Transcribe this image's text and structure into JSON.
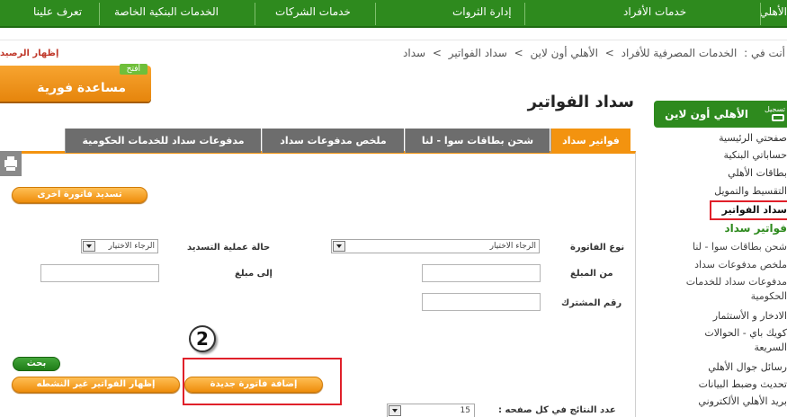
{
  "topnav": {
    "items": [
      "الأهلي",
      "خدمات الأفراد",
      "إدارة الثروات",
      "خدمات الشركات",
      "الخدمات البنكية الخاصة",
      "تعرف علينا"
    ]
  },
  "breadcrumb": {
    "prefix": "أنت في :",
    "items": [
      "الخدمات المصرفية للأفراد",
      "الأهلي أون لاين",
      "سداد الفواتير",
      "سداد"
    ],
    "sep": ">"
  },
  "show_balance": "إظهار الرصيد",
  "quick_help": {
    "badge": "أفتح",
    "label": "مساعدة فورية"
  },
  "page_title": "سداد الفواتير",
  "sidebar": {
    "header": "الأهلي أون لاين",
    "enter_label": "تسجيل",
    "items": [
      "صفحتي الرئيسية",
      "حساباتي البنكية",
      "بطاقات الأهلي",
      "التقسيط والتمويل",
      "سداد الفواتير",
      "فواتير سداد",
      "شحن بطاقات سوا - لنا",
      "ملخص مدفوعات سداد",
      "مدفوعات سداد للخدمات",
      "الحكومية",
      "الادخار و الأستثمار",
      "كويك باي - الحوالات",
      "السريعة",
      "رسائل جوال الأهلي",
      "تحديث وضبط البيانات",
      "بريد الأهلي الألكتروني"
    ]
  },
  "tabs": [
    {
      "label": "فواتير سداد",
      "active": true
    },
    {
      "label": "شحن بطاقات سوا - لنا",
      "active": false
    },
    {
      "label": "ملخص مدفوعات سداد",
      "active": false
    },
    {
      "label": "مدفوعات سداد للخدمات الحكومية",
      "active": false
    }
  ],
  "actions": {
    "pay_another": "تسديد فاتورة اخرى",
    "search": "بحث",
    "show_inactive": "إظهار الفواتير غير النشطه",
    "add_new": "إضافة فاتورة جديدة"
  },
  "form": {
    "bill_type_label": "نوع الفاتورة",
    "bill_type_value": "الرجاء الاختيار",
    "payment_status_label": "حالة عملية التسديد",
    "payment_status_value": "الرجاء الاختيار",
    "from_amount_label": "من المبلغ",
    "to_amount_label": "إلى مبلغ",
    "subscriber_label": "رقم المشترك",
    "results_per_page_label": "عدد النتائج في كل صفحه :",
    "results_per_page_value": "15"
  },
  "annotation": {
    "number": "2"
  },
  "colors": {
    "green": "#2e8a1e",
    "orange": "#f3930f",
    "red": "#e0202a",
    "gray_tab": "#6d6d6d"
  }
}
